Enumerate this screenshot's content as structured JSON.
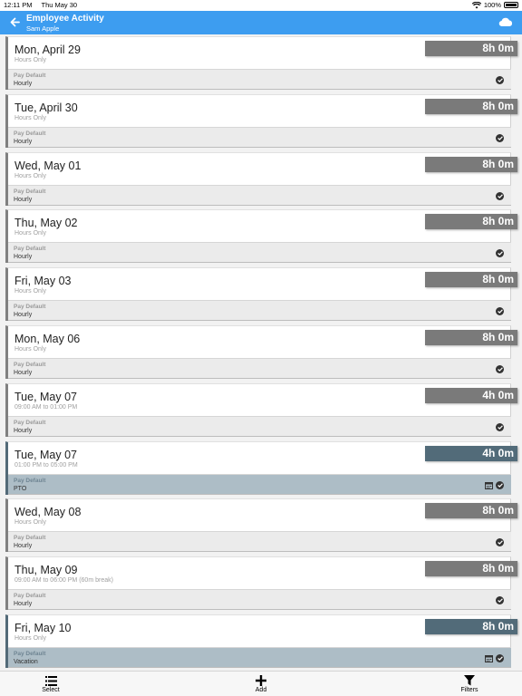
{
  "status_bar": {
    "time": "12:11 PM",
    "date": "Thu May 30",
    "battery": "100%"
  },
  "nav": {
    "title": "Employee Activity",
    "subtitle": "Sam Apple"
  },
  "entries": [
    {
      "date": "Mon, April 29",
      "sub": "Hours Only",
      "hours": "8h 0m",
      "pay_label": "Pay Default",
      "pay_value": "Hourly",
      "calendar": false
    },
    {
      "date": "Tue, April 30",
      "sub": "Hours Only",
      "hours": "8h 0m",
      "pay_label": "Pay Default",
      "pay_value": "Hourly",
      "calendar": false
    },
    {
      "date": "Wed, May 01",
      "sub": "Hours Only",
      "hours": "8h 0m",
      "pay_label": "Pay Default",
      "pay_value": "Hourly",
      "calendar": false
    },
    {
      "date": "Thu, May 02",
      "sub": "Hours Only",
      "hours": "8h 0m",
      "pay_label": "Pay Default",
      "pay_value": "Hourly",
      "calendar": false
    },
    {
      "date": "Fri, May 03",
      "sub": "Hours Only",
      "hours": "8h 0m",
      "pay_label": "Pay Default",
      "pay_value": "Hourly",
      "calendar": false
    },
    {
      "date": "Mon, May 06",
      "sub": "Hours Only",
      "hours": "8h 0m",
      "pay_label": "Pay Default",
      "pay_value": "Hourly",
      "calendar": false
    },
    {
      "date": "Tue, May 07",
      "sub": "09:00 AM to 01:00 PM",
      "hours": "4h 0m",
      "pay_label": "Pay Default",
      "pay_value": "Hourly",
      "calendar": false
    },
    {
      "date": "Tue, May 07",
      "sub": "01:00 PM to 05:00 PM",
      "hours": "4h 0m",
      "pay_label": "Pay Default",
      "pay_value": "PTO",
      "calendar": true
    },
    {
      "date": "Wed, May 08",
      "sub": "Hours Only",
      "hours": "8h 0m",
      "pay_label": "Pay Default",
      "pay_value": "Hourly",
      "calendar": false
    },
    {
      "date": "Thu, May 09",
      "sub": "09:00 AM to 06:00 PM (60m break)",
      "hours": "8h 0m",
      "pay_label": "Pay Default",
      "pay_value": "Hourly",
      "calendar": false
    },
    {
      "date": "Fri, May 10",
      "sub": "Hours Only",
      "hours": "8h 0m",
      "pay_label": "Pay Default",
      "pay_value": "Vacation",
      "calendar": true
    }
  ],
  "tabbar": {
    "select": "Select",
    "add": "Add",
    "filters": "Filters"
  }
}
